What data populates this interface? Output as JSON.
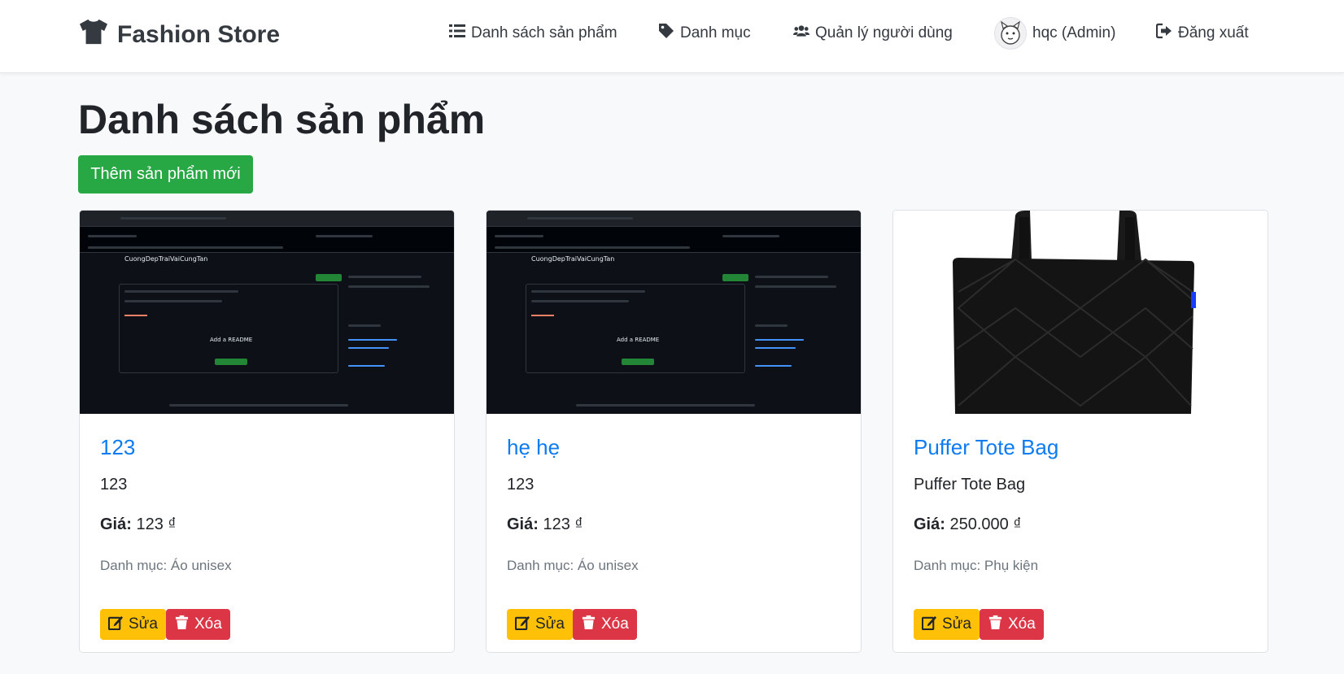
{
  "navbar": {
    "brand": "Fashion Store",
    "brand_icon": "tshirt-icon",
    "items": [
      {
        "label": "Danh sách sản phẩm",
        "icon": "list-icon"
      },
      {
        "label": "Danh mục",
        "icon": "tag-icon"
      },
      {
        "label": "Quản lý người dùng",
        "icon": "users-icon"
      },
      {
        "label": "hqc (Admin)",
        "icon": "avatar"
      },
      {
        "label": "Đăng xuất",
        "icon": "sign-out-icon"
      }
    ]
  },
  "page": {
    "title": "Danh sách sản phẩm",
    "add_button": "Thêm sản phẩm mới"
  },
  "products": [
    {
      "name": "123",
      "description": "123",
      "price_label": "Giá:",
      "price": "123 ₫",
      "category": "Danh mục: Áo unisex",
      "image": "github-repo-screenshot",
      "edit_label": "Sửa",
      "delete_label": "Xóa"
    },
    {
      "name": "hẹ hẹ",
      "description": "123",
      "price_label": "Giá:",
      "price": "123 ₫",
      "category": "Danh mục: Áo unisex",
      "image": "github-repo-screenshot",
      "edit_label": "Sửa",
      "delete_label": "Xóa"
    },
    {
      "name": "Puffer Tote Bag",
      "description": "Puffer Tote Bag",
      "price_label": "Giá:",
      "price": "250.000 ₫",
      "category": "Danh mục: Phụ kiện",
      "image": "black-quilted-tote-bag",
      "edit_label": "Sửa",
      "delete_label": "Xóa"
    }
  ],
  "thumbnail": {
    "repo_name": "CuongDepTraiVaiCungTan",
    "readme_title": "Add a README",
    "readme_button": "Add a README"
  },
  "colors": {
    "primary_link": "#0d7bf2",
    "success": "#28a745",
    "warning": "#ffc107",
    "danger": "#dc3545",
    "text_dark": "#343a40",
    "muted": "#6c757d"
  }
}
